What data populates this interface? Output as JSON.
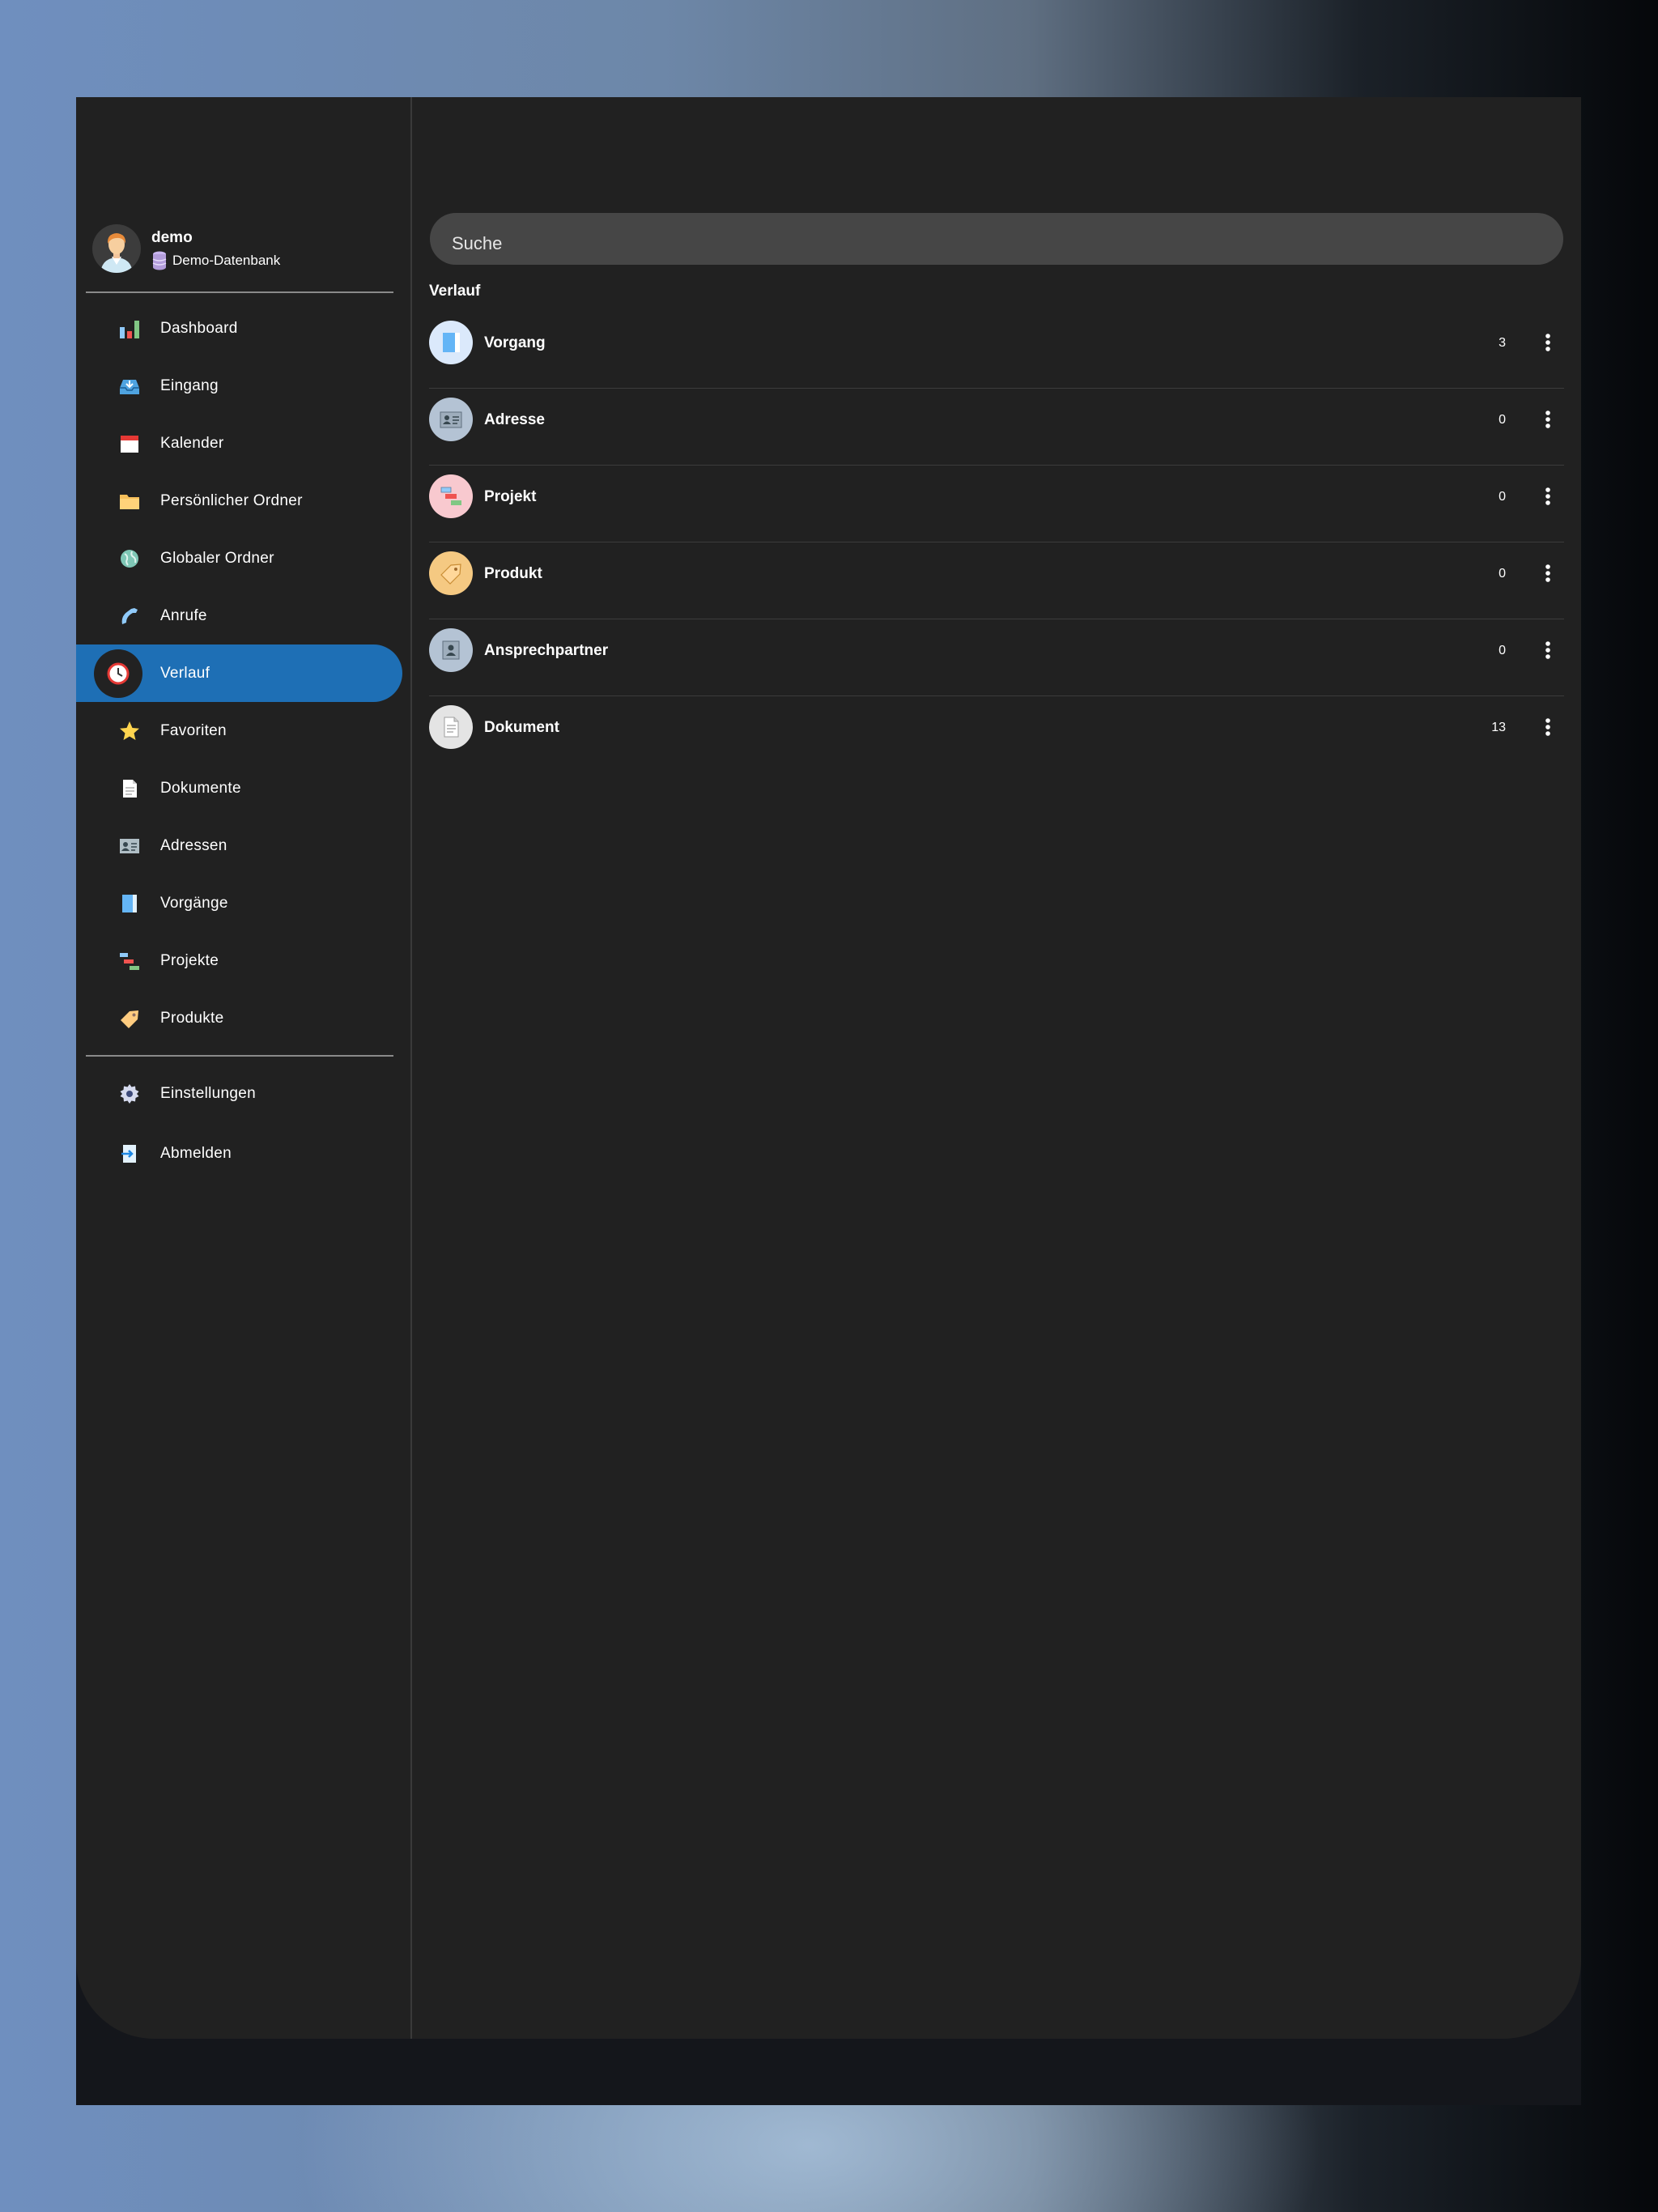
{
  "user": {
    "name": "demo",
    "database": "Demo-Datenbank"
  },
  "nav": {
    "items": [
      {
        "label": "Dashboard"
      },
      {
        "label": "Eingang"
      },
      {
        "label": "Kalender"
      },
      {
        "label": "Persönlicher Ordner"
      },
      {
        "label": "Globaler Ordner"
      },
      {
        "label": "Anrufe"
      },
      {
        "label": "Verlauf"
      },
      {
        "label": "Favoriten"
      },
      {
        "label": "Dokumente"
      },
      {
        "label": "Adressen"
      },
      {
        "label": "Vorgänge"
      },
      {
        "label": "Projekte"
      },
      {
        "label": "Produkte"
      }
    ],
    "active": "Verlauf",
    "footer": [
      {
        "label": "Einstellungen"
      },
      {
        "label": "Abmelden"
      }
    ]
  },
  "search": {
    "placeholder": "Suche"
  },
  "history": {
    "title": "Verlauf",
    "rows": [
      {
        "title": "Vorgang",
        "count": "3"
      },
      {
        "title": "Adresse",
        "count": "0"
      },
      {
        "title": "Projekt",
        "count": "0"
      },
      {
        "title": "Produkt",
        "count": "0"
      },
      {
        "title": "Ansprechpartner",
        "count": "0"
      },
      {
        "title": "Dokument",
        "count": "13"
      }
    ]
  },
  "colors": {
    "accent": "#1e6fb5",
    "background": "#212121",
    "search": "#464646"
  }
}
